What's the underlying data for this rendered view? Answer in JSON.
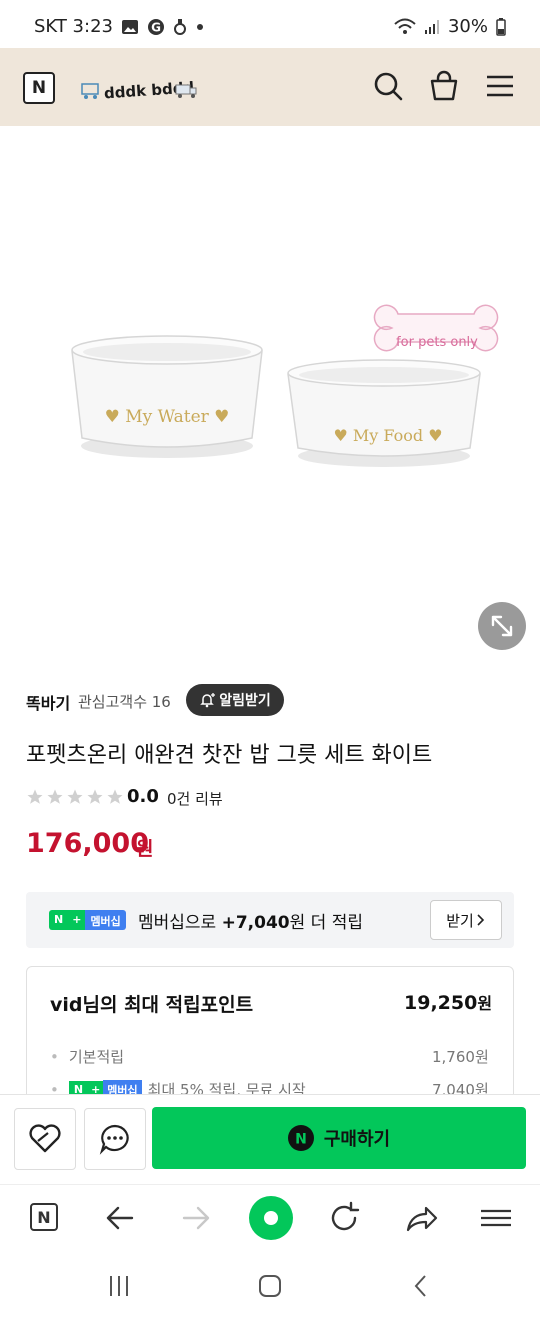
{
  "status_bar": {
    "carrier_time": "SKT 3:23",
    "battery": "30%",
    "icons": [
      "image-icon",
      "g-icon",
      "hand-icon",
      "dot-icon",
      "wifi-icon",
      "signal-icon",
      "battery-icon"
    ]
  },
  "header": {
    "logo_letter": "N",
    "brand_text": "dddk bddd",
    "icons": [
      "search-icon",
      "cart-icon",
      "menu-icon"
    ]
  },
  "product_image": {
    "left_bowl_text": "♥ My Water ♥",
    "right_bowl_text": "♥ My Food ♥",
    "tag_text": "for pets only"
  },
  "store": {
    "name": "똑바기",
    "fans": "관심고객수 16",
    "alarm_label": "알림받기"
  },
  "product": {
    "title": "포펫츠온리 애완견 찻잔 밥 그릇 세트 화이트",
    "rating": "0.0",
    "reviews": "0건 리뷰",
    "rating_stars": 0,
    "price": "176,000",
    "price_unit": "원"
  },
  "membership": {
    "badge_n": "N",
    "badge_plus": "+",
    "badge_text": "멤버십",
    "text_prefix": "멤버십으로 ",
    "amount": "+7,040",
    "text_suffix": "원 더 적립",
    "button": "받기"
  },
  "points": {
    "title": "vid님의 최대 적립포인트",
    "total": "19,250",
    "total_unit": "원",
    "rows": [
      {
        "label": "기본적립",
        "value": "1,760원"
      },
      {
        "label": "최대 5% 적립, 무료 시작",
        "value": "7,040원"
      }
    ]
  },
  "actions": {
    "buy_label": "구매하기",
    "buy_icon_letter": "N"
  },
  "colors": {
    "accent_green": "#03c75a",
    "price_red": "#c4122f",
    "header_bg": "#efe6da"
  }
}
